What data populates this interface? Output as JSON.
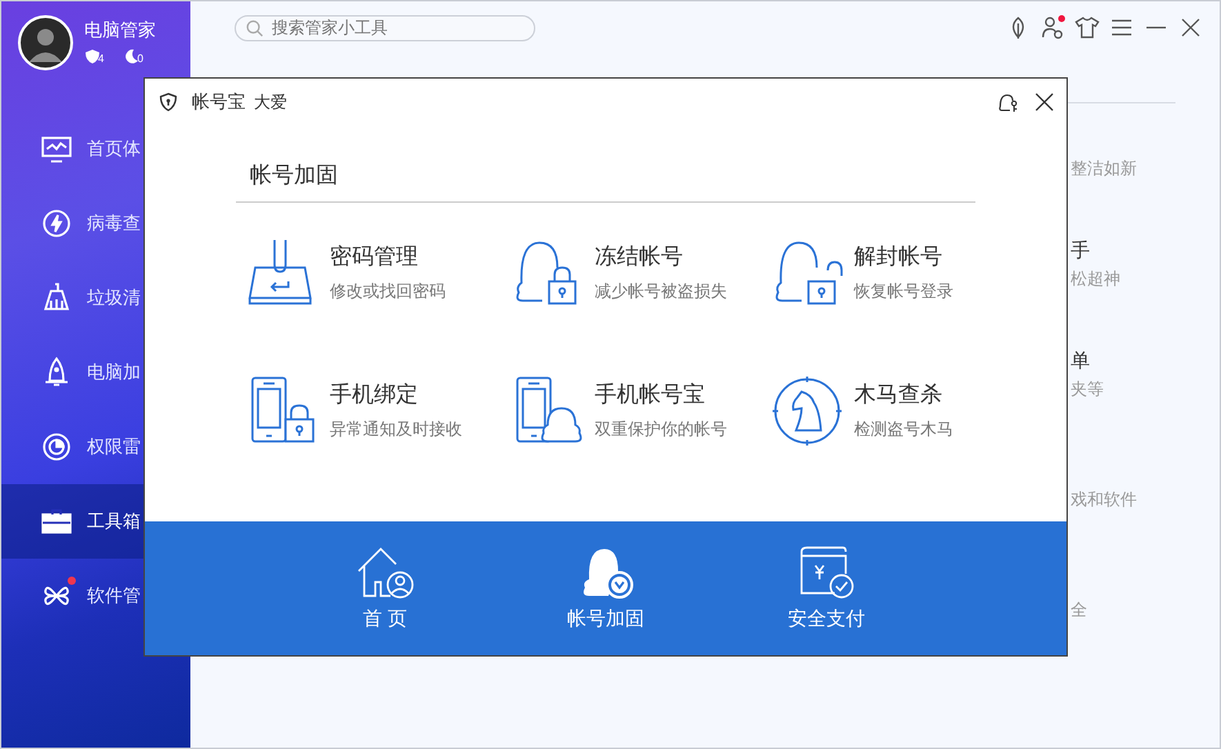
{
  "sidebar": {
    "user": {
      "name": "电脑管家",
      "badges": [
        {
          "kind": "shield",
          "count": "4"
        },
        {
          "kind": "moon",
          "count": "0"
        }
      ]
    },
    "items": [
      {
        "label": "首页体",
        "kind": "monitor",
        "selected": false,
        "notify": false
      },
      {
        "label": "病毒查",
        "kind": "bolt",
        "selected": false,
        "notify": false
      },
      {
        "label": "垃圾清",
        "kind": "broom",
        "selected": false,
        "notify": false
      },
      {
        "label": "电脑加",
        "kind": "rocket",
        "selected": false,
        "notify": false
      },
      {
        "label": "权限雷",
        "kind": "radar",
        "selected": false,
        "notify": false
      },
      {
        "label": "工具箱",
        "kind": "toolbox",
        "selected": true,
        "notify": false
      },
      {
        "label": "软件管",
        "kind": "clover",
        "selected": false,
        "notify": true
      }
    ]
  },
  "search": {
    "placeholder": "搜索管家小工具"
  },
  "toolbar": [
    {
      "kind": "leaf",
      "notify": false
    },
    {
      "kind": "user",
      "notify": true
    },
    {
      "kind": "shirt",
      "notify": false
    },
    {
      "kind": "menu",
      "notify": false
    },
    {
      "kind": "minimize",
      "notify": false
    },
    {
      "kind": "close",
      "notify": false
    }
  ],
  "tools": [
    {
      "desc": "整洁如新"
    },
    {
      "title": "手",
      "desc": "松超神"
    },
    {
      "title": "单",
      "desc": "夹等"
    },
    {
      "desc": "戏和软件"
    },
    {
      "desc": "全"
    }
  ],
  "dialog": {
    "title": "帐号宝",
    "user": "大爱",
    "section": "帐号加固",
    "features": [
      {
        "kind": "keyboard",
        "title": "密码管理",
        "desc": "修改或找回密码"
      },
      {
        "kind": "penguin-lock",
        "title": "冻结帐号",
        "desc": "减少帐号被盗损失"
      },
      {
        "kind": "penguin-unlock",
        "title": "解封帐号",
        "desc": "恢复帐号登录"
      },
      {
        "kind": "phone-lock",
        "title": "手机绑定",
        "desc": "异常通知及时接收"
      },
      {
        "kind": "phone-penguin",
        "title": "手机帐号宝",
        "desc": "双重保护你的帐号"
      },
      {
        "kind": "knight",
        "title": "木马查杀",
        "desc": "检测盗号木马"
      }
    ],
    "nav": [
      {
        "kind": "home",
        "label": "首 页"
      },
      {
        "kind": "penguin",
        "label": "帐号加固"
      },
      {
        "kind": "wallet",
        "label": "安全支付"
      }
    ]
  }
}
